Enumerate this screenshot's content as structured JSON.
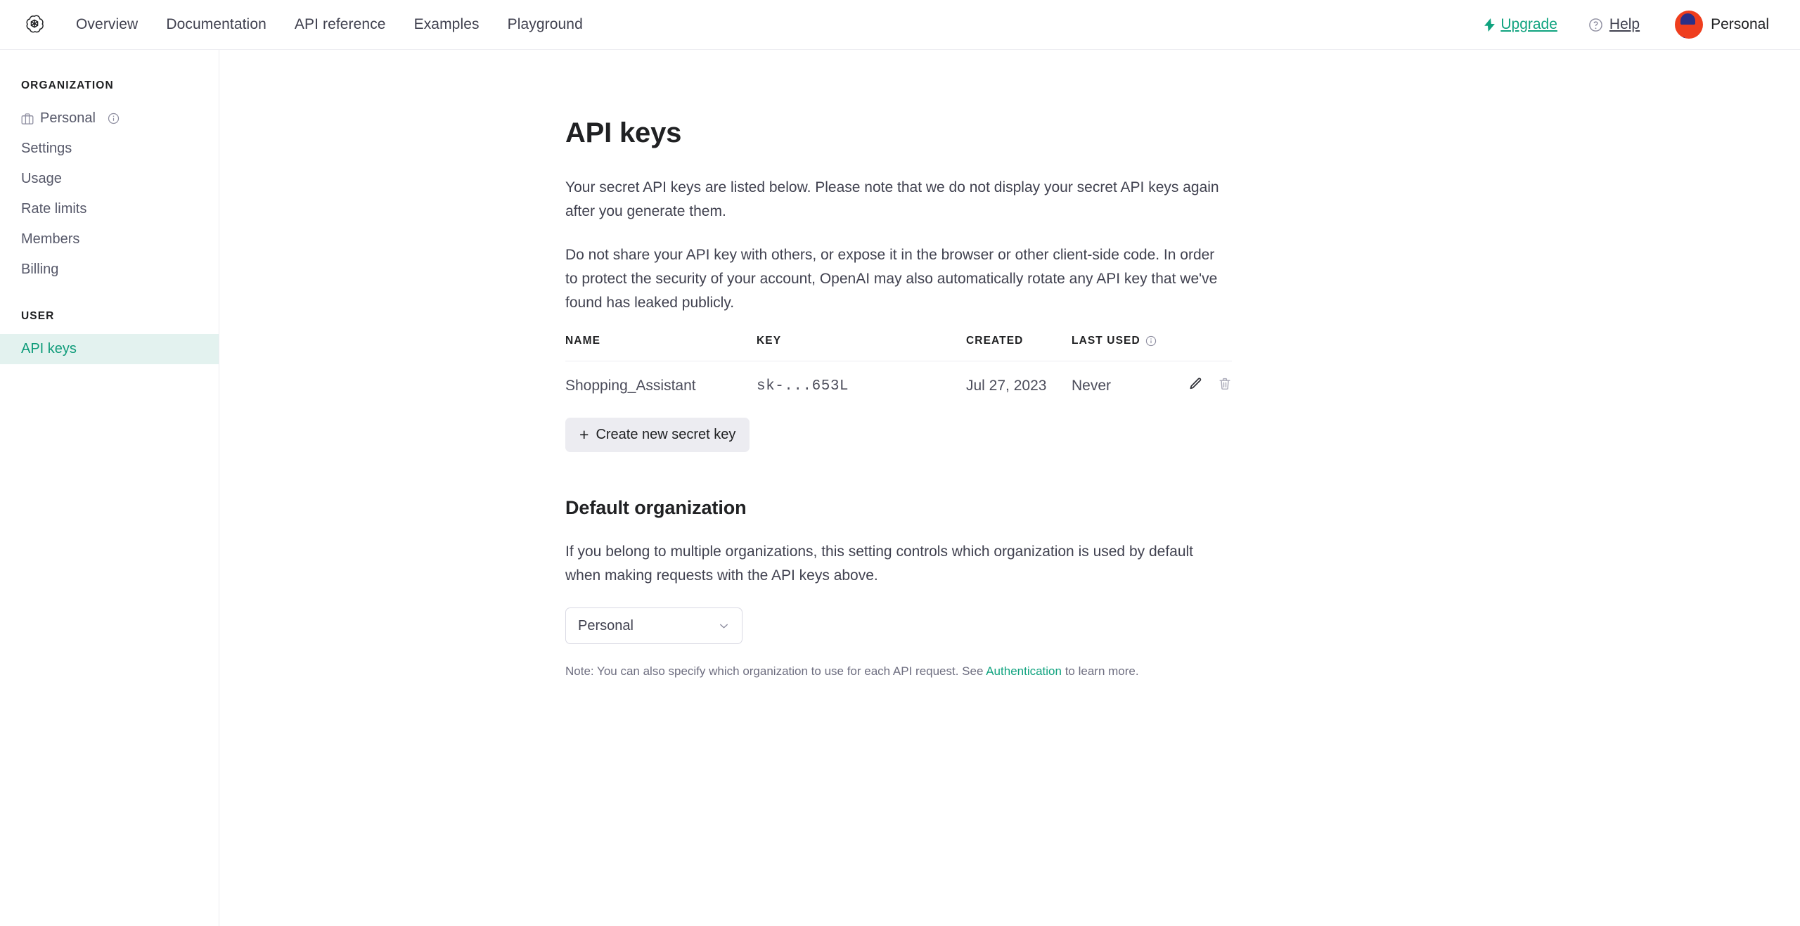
{
  "topnav": {
    "logo_icon": "openai-logo-icon",
    "links": [
      {
        "label": "Overview"
      },
      {
        "label": "Documentation"
      },
      {
        "label": "API reference"
      },
      {
        "label": "Examples"
      },
      {
        "label": "Playground"
      }
    ],
    "upgrade": {
      "label": "Upgrade",
      "icon": "lightning-bolt-icon",
      "color": "#10a37f"
    },
    "help": {
      "label": "Help",
      "icon": "question-circle-icon"
    },
    "account": {
      "name": "Personal",
      "avatar_colors": {
        "background": "#ef3e1e",
        "mark": "#2b3087"
      }
    }
  },
  "sidebar": {
    "organization_label": "ORGANIZATION",
    "org_items": [
      {
        "label": "Personal",
        "icon": "briefcase-icon",
        "info_icon": "info-circle-icon"
      },
      {
        "label": "Settings"
      },
      {
        "label": "Usage"
      },
      {
        "label": "Rate limits"
      },
      {
        "label": "Members"
      },
      {
        "label": "Billing"
      }
    ],
    "user_label": "USER",
    "user_items": [
      {
        "label": "API keys",
        "active": true
      }
    ],
    "active_color": "#0e9b79",
    "active_background": "#e3f2ef"
  },
  "main": {
    "title": "API keys",
    "paragraphs": [
      "Your secret API keys are listed below. Please note that we do not display your secret API keys again after you generate them.",
      "Do not share your API key with others, or expose it in the browser or other client-side code. In order to protect the security of your account, OpenAI may also automatically rotate any API key that we've found has leaked publicly."
    ],
    "table": {
      "columns": [
        "NAME",
        "KEY",
        "CREATED",
        "LAST USED"
      ],
      "last_used_info_icon": "info-circle-icon",
      "rows": [
        {
          "name": "Shopping_Assistant",
          "key": "sk-...653L",
          "created": "Jul 27, 2023",
          "last_used": "Never",
          "edit_icon": "pencil-icon",
          "delete_icon": "trash-icon"
        }
      ]
    },
    "create_key_button": {
      "label": "Create new secret key",
      "icon": "plus-icon"
    },
    "default_org": {
      "title": "Default organization",
      "description": "If you belong to multiple organizations, this setting controls which organization is used by default when making requests with the API keys above.",
      "select": {
        "value": "Personal",
        "chevron_icon": "chevron-down-icon"
      },
      "note_prefix": "Note: You can also specify which organization to use for each API request. See ",
      "note_link": "Authentication",
      "note_suffix": " to learn more."
    }
  }
}
